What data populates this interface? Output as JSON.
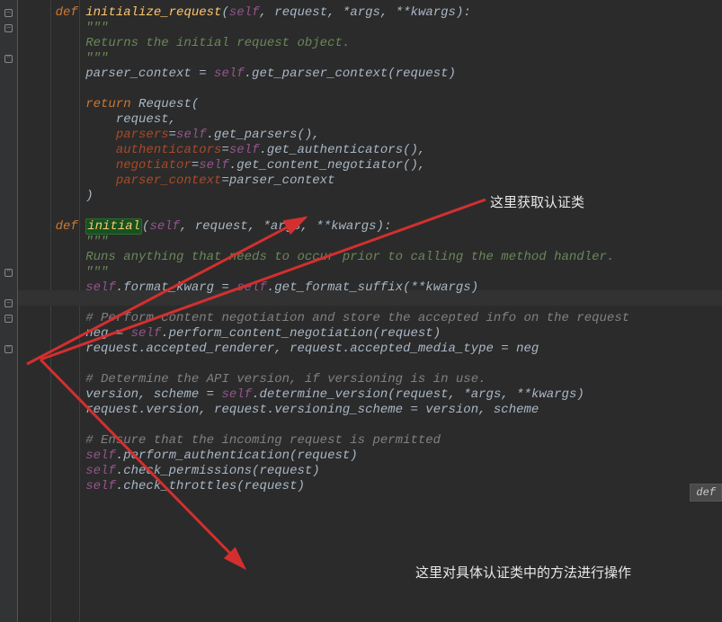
{
  "annotations": {
    "a1": "这里获取认证类",
    "a2": "这里对具体认证类中的方法进行操作"
  },
  "hint": {
    "label": "def"
  },
  "code": {
    "l1_def": "def",
    "l1_fn": "initialize_request",
    "l1_open": "(",
    "l1_self": "self",
    "l1_sep1": ", ",
    "l1_p1": "request",
    "l1_sep2": ", *",
    "l1_p2": "args",
    "l1_sep3": ", **",
    "l1_p3": "kwargs",
    "l1_close": "):",
    "l2": "\"\"\"",
    "l3": "Returns the initial request object.",
    "l4": "\"\"\"",
    "l5a": "parser_context = ",
    "l5_self": "self",
    "l5b": ".get_parser_context(",
    "l5_arg": "request",
    "l5c": ")",
    "l7a": "return",
    "l7b": " Request(",
    "l8": "request",
    "l8c": ",",
    "l9k": "parsers",
    "l9a": "=",
    "l9s": "self",
    "l9b": ".get_parsers(),",
    "l10k": "authenticators",
    "l10a": "=",
    "l10s": "self",
    "l10b": ".get_authenticators(),",
    "l11k": "negotiator",
    "l11a": "=",
    "l11s": "self",
    "l11b": ".get_content_negotiator(),",
    "l12k": "parser_context",
    "l12a": "=parser_context",
    "l13": ")",
    "l15_def": "def",
    "l15_fn": "initial",
    "l15_open": "(",
    "l15_self": "self",
    "l15_sep1": ", ",
    "l15_p1": "request",
    "l15_sep2": ", *",
    "l15_p2": "args",
    "l15_sep3": ", **",
    "l15_p3": "kwargs",
    "l15_close": "):",
    "l16": "\"\"\"",
    "l17": "Runs anything that needs to occur prior to calling the method handler.",
    "l18": "\"\"\"",
    "l19s": "self",
    "l19a": ".format_kwarg = ",
    "l19s2": "self",
    "l19b": ".get_format_suffix(**",
    "l19arg": "kwargs",
    "l19c": ")",
    "l21": "# Perform content negotiation and store the accepted info on the request",
    "l22a": "neg = ",
    "l22s": "self",
    "l22b": ".perform_content_negotiation(",
    "l22arg": "request",
    "l22c": ")",
    "l23arg1": "request",
    "l23a": ".accepted_renderer, ",
    "l23arg2": "request",
    "l23b": ".accepted_media_type = neg",
    "l25": "# Determine the API version, if versioning is in use.",
    "l26a": "version, scheme = ",
    "l26s": "self",
    "l26b": ".determine_version(",
    "l26arg1": "request",
    "l26c": ", *",
    "l26arg2": "args",
    "l26d": ", **",
    "l26arg3": "kwargs",
    "l26e": ")",
    "l27arg1": "request",
    "l27a": ".version, ",
    "l27arg2": "request",
    "l27b": ".versioning_scheme = version, scheme",
    "l29": "# Ensure that the incoming request is permitted",
    "l30s": "self",
    "l30a": ".perform_authentication(",
    "l30arg": "request",
    "l30b": ")",
    "l31s": "self",
    "l31a": ".check_permissions(",
    "l31arg": "request",
    "l31b": ")",
    "l32s": "self",
    "l32a": ".check_throttles(",
    "l32arg": "request",
    "l32b": ")"
  }
}
